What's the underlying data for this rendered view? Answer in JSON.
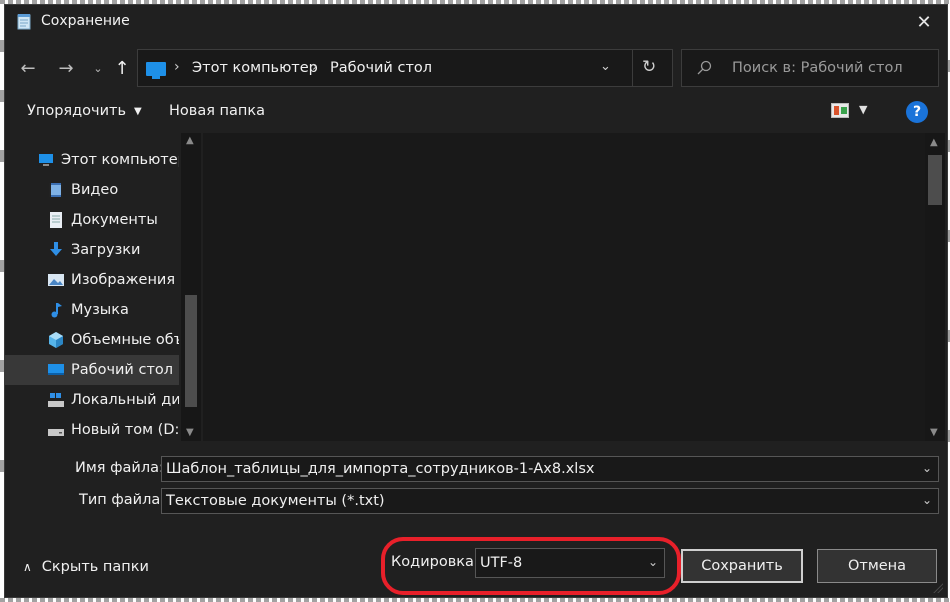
{
  "window": {
    "title": "Сохранение"
  },
  "address": {
    "segments": [
      "Этот компьютер",
      "Рабочий стол"
    ],
    "search_placeholder": "Поиск в: Рабочий стол"
  },
  "toolbar": {
    "organize_label": "Упорядочить",
    "new_folder_label": "Новая папка",
    "help_label": "?"
  },
  "sidebar": {
    "items": [
      {
        "label": "Этот компьютер",
        "icon": "computer-icon"
      },
      {
        "label": "Видео",
        "icon": "video-icon"
      },
      {
        "label": "Документы",
        "icon": "documents-icon"
      },
      {
        "label": "Загрузки",
        "icon": "downloads-icon"
      },
      {
        "label": "Изображения",
        "icon": "pictures-icon"
      },
      {
        "label": "Музыка",
        "icon": "music-icon"
      },
      {
        "label": "Объемные объекты",
        "icon": "3d-objects-icon"
      },
      {
        "label": "Рабочий стол",
        "icon": "desktop-icon",
        "selected": true
      },
      {
        "label": "Локальный диск (C:)",
        "icon": "local-disk-icon"
      },
      {
        "label": "Новый том (D:)",
        "icon": "volume-icon"
      }
    ]
  },
  "form": {
    "filename_label": "Имя файла:",
    "filename_value": "Шаблон_таблицы_для_импорта_сотрудников-1-Ax8.xlsx",
    "filetype_label": "Тип файла:",
    "filetype_value": "Текстовые документы (*.txt)",
    "encoding_label": "Кодировка:",
    "encoding_value": "UTF-8"
  },
  "footer": {
    "hide_folders_label": "Скрыть папки",
    "save_label": "Сохранить",
    "cancel_label": "Отмена"
  },
  "colors": {
    "accent": "#1e90e8",
    "highlight": "#e8202a",
    "background": "#202020"
  }
}
